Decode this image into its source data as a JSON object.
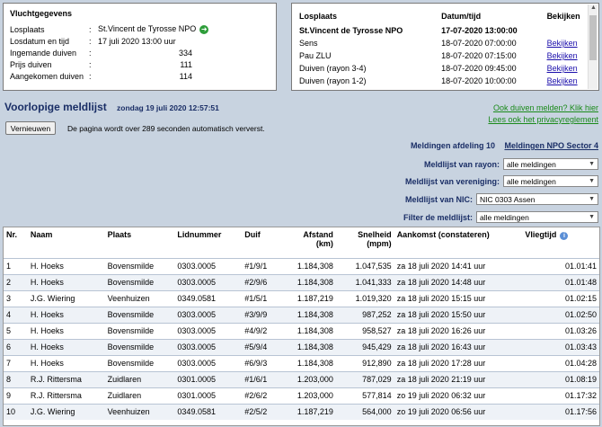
{
  "flight": {
    "heading": "Vluchtgegevens",
    "fields": [
      {
        "label": "Losplaats",
        "value": "St.Vincent de Tyrosse NPO"
      },
      {
        "label": "Losdatum en tijd",
        "value": "17 juli 2020 13:00 uur"
      },
      {
        "label": "Ingemande duiven",
        "value": "334"
      },
      {
        "label": "Prijs duiven",
        "value": "111"
      },
      {
        "label": "Aangekomen duiven",
        "value": "114"
      }
    ]
  },
  "releases": {
    "headers": [
      "Losplaats",
      "Datum/tijd",
      "Bekijken"
    ],
    "rows": [
      {
        "place": "St.Vincent de Tyrosse NPO",
        "datetime": "17-07-2020 13:00:00",
        "view": ""
      },
      {
        "place": "Sens",
        "datetime": "18-07-2020 07:00:00",
        "view": "Bekijken"
      },
      {
        "place": "Pau ZLU",
        "datetime": "18-07-2020 07:15:00",
        "view": "Bekijken"
      },
      {
        "place": "Duiven (rayon 3-4)",
        "datetime": "18-07-2020 09:45:00",
        "view": "Bekijken"
      },
      {
        "place": "Duiven (rayon 1-2)",
        "datetime": "18-07-2020 10:00:00",
        "view": "Bekijken"
      }
    ]
  },
  "page": {
    "title": "Voorlopige meldlijst",
    "date": "zondag 19 juli 2020 12:57:51",
    "link_report": "Ook duiven melden? Klik hier",
    "link_privacy": "Lees ook het privacyreglement",
    "refresh_label": "Vernieuwen",
    "refresh_text": "De pagina wordt over 289 seconden automatisch ververst.",
    "meldingen_afdeling": "Meldingen afdeling 10",
    "meldingen_sector": "Meldingen NPO Sector 4"
  },
  "filters": [
    {
      "label": "Meldlijst van rayon:",
      "value": "alle meldingen"
    },
    {
      "label": "Meldlijst van vereniging:",
      "value": "alle meldingen"
    },
    {
      "label": "Meldlijst van NIC:",
      "value": "NIC 0303 Assen"
    },
    {
      "label": "Filter de meldlijst:",
      "value": "alle meldingen"
    }
  ],
  "results": {
    "headers": {
      "nr": "Nr.",
      "naam": "Naam",
      "plaats": "Plaats",
      "lidnummer": "Lidnummer",
      "duif": "Duif",
      "afstand": "Afstand",
      "afstand_unit": "(km)",
      "snelheid": "Snelheid",
      "snelheid_unit": "(mpm)",
      "aankomst": "Aankomst (constateren)",
      "vliegtijd": "Vliegtijd"
    },
    "rows": [
      {
        "nr": "1",
        "naam": "H. Hoeks",
        "plaats": "Bovensmilde",
        "lid": "0303.0005",
        "duif": "#1/9/1",
        "afstand": "1.184,308",
        "snelheid": "1.047,535",
        "aankomst": "za 18 juli 2020 14:41 uur",
        "vliegtijd": "01.01:41"
      },
      {
        "nr": "2",
        "naam": "H. Hoeks",
        "plaats": "Bovensmilde",
        "lid": "0303.0005",
        "duif": "#2/9/6",
        "afstand": "1.184,308",
        "snelheid": "1.041,333",
        "aankomst": "za 18 juli 2020 14:48 uur",
        "vliegtijd": "01.01:48"
      },
      {
        "nr": "3",
        "naam": "J.G. Wiering",
        "plaats": "Veenhuizen",
        "lid": "0349.0581",
        "duif": "#1/5/1",
        "afstand": "1.187,219",
        "snelheid": "1.019,320",
        "aankomst": "za 18 juli 2020 15:15 uur",
        "vliegtijd": "01.02:15"
      },
      {
        "nr": "4",
        "naam": "H. Hoeks",
        "plaats": "Bovensmilde",
        "lid": "0303.0005",
        "duif": "#3/9/9",
        "afstand": "1.184,308",
        "snelheid": "987,252",
        "aankomst": "za 18 juli 2020 15:50 uur",
        "vliegtijd": "01.02:50"
      },
      {
        "nr": "5",
        "naam": "H. Hoeks",
        "plaats": "Bovensmilde",
        "lid": "0303.0005",
        "duif": "#4/9/2",
        "afstand": "1.184,308",
        "snelheid": "958,527",
        "aankomst": "za 18 juli 2020 16:26 uur",
        "vliegtijd": "01.03:26"
      },
      {
        "nr": "6",
        "naam": "H. Hoeks",
        "plaats": "Bovensmilde",
        "lid": "0303.0005",
        "duif": "#5/9/4",
        "afstand": "1.184,308",
        "snelheid": "945,429",
        "aankomst": "za 18 juli 2020 16:43 uur",
        "vliegtijd": "01.03:43"
      },
      {
        "nr": "7",
        "naam": "H. Hoeks",
        "plaats": "Bovensmilde",
        "lid": "0303.0005",
        "duif": "#6/9/3",
        "afstand": "1.184,308",
        "snelheid": "912,890",
        "aankomst": "za 18 juli 2020 17:28 uur",
        "vliegtijd": "01.04:28"
      },
      {
        "nr": "8",
        "naam": "R.J. Rittersma",
        "plaats": "Zuidlaren",
        "lid": "0301.0005",
        "duif": "#1/6/1",
        "afstand": "1.203,000",
        "snelheid": "787,029",
        "aankomst": "za 18 juli 2020 21:19 uur",
        "vliegtijd": "01.08:19"
      },
      {
        "nr": "9",
        "naam": "R.J. Rittersma",
        "plaats": "Zuidlaren",
        "lid": "0301.0005",
        "duif": "#2/6/2",
        "afstand": "1.203,000",
        "snelheid": "577,814",
        "aankomst": "zo 19 juli 2020 06:32 uur",
        "vliegtijd": "01.17:32"
      },
      {
        "nr": "10",
        "naam": "J.G. Wiering",
        "plaats": "Veenhuizen",
        "lid": "0349.0581",
        "duif": "#2/5/2",
        "afstand": "1.187,219",
        "snelheid": "564,000",
        "aankomst": "zo 19 juli 2020 06:56 uur",
        "vliegtijd": "01.17:56"
      }
    ]
  }
}
